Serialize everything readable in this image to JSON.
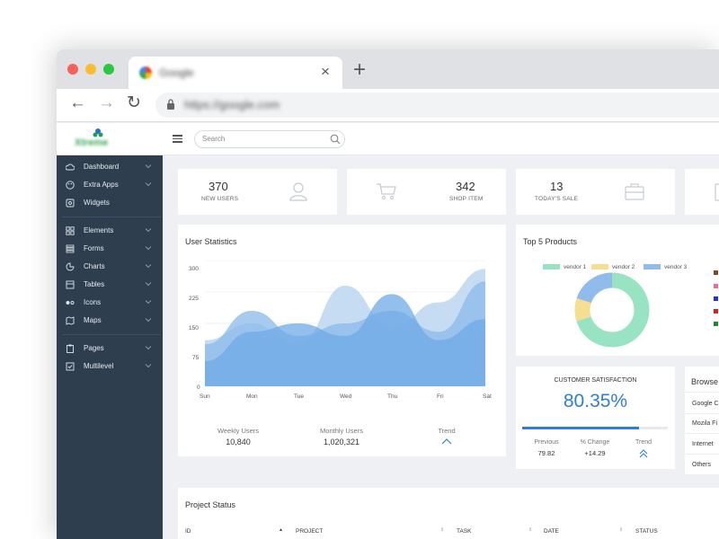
{
  "browser": {
    "tab_title": "Google",
    "url": "https://google.com",
    "close_glyph": "×",
    "new_tab_glyph": "+",
    "back_glyph": "←",
    "forward_glyph": "→",
    "reload_glyph": "↻"
  },
  "app": {
    "logo_text": "Xtreme",
    "search_placeholder": "Search"
  },
  "sidebar": {
    "items": [
      {
        "label": "Dashboard",
        "icon": "cloud-icon",
        "chevron": true
      },
      {
        "label": "Extra Apps",
        "icon": "palette-icon",
        "chevron": true
      },
      {
        "label": "Widgets",
        "icon": "widget-icon",
        "chevron": false
      },
      {
        "label": "Elements",
        "icon": "grid-icon",
        "chevron": true
      },
      {
        "label": "Forms",
        "icon": "forms-icon",
        "chevron": true
      },
      {
        "label": "Charts",
        "icon": "pie-chart-icon",
        "chevron": true
      },
      {
        "label": "Tables",
        "icon": "table-icon",
        "chevron": true
      },
      {
        "label": "Icons",
        "icon": "toggle-icon",
        "chevron": true
      },
      {
        "label": "Maps",
        "icon": "map-icon",
        "chevron": true
      },
      {
        "label": "Pages",
        "icon": "clipboard-icon",
        "chevron": true
      },
      {
        "label": "Multilevel",
        "icon": "checkbox-icon",
        "chevron": true
      }
    ]
  },
  "stats": [
    {
      "value": "370",
      "label": "NEW USERS",
      "icon": "user-icon"
    },
    {
      "value": "342",
      "label": "SHOP ITEM",
      "icon": "cart-icon"
    },
    {
      "value": "13",
      "label": "TODAY'S SALE",
      "icon": "briefcase-icon"
    }
  ],
  "user_stats": {
    "title": "User Statistics",
    "footer": [
      {
        "label": "Weekly Users",
        "value": "10,840"
      },
      {
        "label": "Monthly Users",
        "value": "1,020,321"
      },
      {
        "label": "Trend",
        "value": ""
      }
    ],
    "chart_data": {
      "type": "area",
      "categories": [
        "Sun",
        "Mon",
        "Tue",
        "Wed",
        "Thu",
        "Fri",
        "Sat"
      ],
      "yticks": [
        "300",
        "225",
        "150",
        "75",
        "0"
      ],
      "ylim": [
        0,
        300
      ],
      "series": [
        {
          "values": [
            110,
            150,
            100,
            240,
            140,
            200,
            280
          ]
        },
        {
          "values": [
            100,
            180,
            120,
            150,
            180,
            130,
            250
          ]
        },
        {
          "values": [
            60,
            130,
            150,
            120,
            220,
            110,
            160
          ]
        }
      ],
      "colors": [
        "#bcd6f1",
        "#8ab9ea",
        "#6ea9e6"
      ]
    }
  },
  "top_products": {
    "title": "Top 5 Products",
    "chart_data": {
      "type": "pie",
      "categories": [
        "vendor 1",
        "vendor 2",
        "vendor 3"
      ],
      "values": [
        70,
        10,
        20
      ],
      "colors": [
        "#97e3c2",
        "#f6de90",
        "#8fbceb"
      ]
    },
    "side_colors": [
      "#7a4b2a",
      "#e86b9a",
      "#2233dd",
      "#dd1c1c",
      "#1f8a2c"
    ]
  },
  "satisfaction": {
    "title": "CUSTOMER SATISFACTION",
    "value": "80.35%",
    "progress": 0.8035,
    "stats": [
      {
        "label": "Previous",
        "value": "79.82"
      },
      {
        "label": "% Change",
        "value": "+14.29"
      },
      {
        "label": "Trend",
        "value": ""
      }
    ],
    "accent": "#2f7fd1"
  },
  "browse": {
    "title": "Browse",
    "items": [
      "Google C",
      "Mozila Fi",
      "Internet",
      "Others"
    ]
  },
  "project_status": {
    "title": "Project Status",
    "columns": [
      "ID",
      "PROJECT",
      "TASK",
      "DATE",
      "STATUS"
    ]
  }
}
